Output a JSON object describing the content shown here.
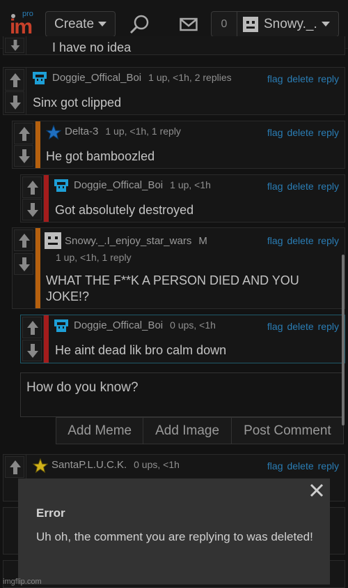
{
  "header": {
    "logo_pro": "pro",
    "logo_im": "im",
    "create_label": "Create",
    "notif_count": "0",
    "username": "Snowy._."
  },
  "prev_comment": {
    "body": "I have no idea"
  },
  "comments": [
    {
      "user": "Doggie_Offical_Boi",
      "meta": "1 up, <1h, 2 replies",
      "body": "Sinx got clipped"
    },
    {
      "user": "Delta-3",
      "meta": "1 up, <1h, 1 reply",
      "body": "He got bamboozled"
    },
    {
      "user": "Doggie_Offical_Boi",
      "meta": "1 up, <1h",
      "body": "Got absolutely destroyed"
    },
    {
      "user": "Snowy._.I_enjoy_star_wars",
      "badge": "M",
      "meta": "1 up, <1h, 1 reply",
      "body": "WHAT THE F**K A PERSON DIED AND YOU JOKE!?"
    },
    {
      "user": "Doggie_Offical_Boi",
      "meta": "0 ups, <1h",
      "body": "He aint dead lik bro calm down"
    },
    {
      "user": "SantaP.L.U.C.K.",
      "meta": "0 ups, <1h",
      "body": ""
    }
  ],
  "actions": {
    "flag": "flag",
    "delete": "delete",
    "reply": "reply"
  },
  "reply_box": {
    "text": "How do you know?",
    "add_meme": "Add Meme",
    "add_image": "Add Image",
    "post_comment": "Post Comment"
  },
  "modal": {
    "title": "Error",
    "message": "Uh oh, the comment you are replying to was deleted!"
  },
  "watermark": "imgflip.com",
  "colors": {
    "link": "#2a7db5",
    "stripe_orange": "#b5600e",
    "stripe_red": "#a41c1c",
    "modal_bg": "#333333"
  }
}
